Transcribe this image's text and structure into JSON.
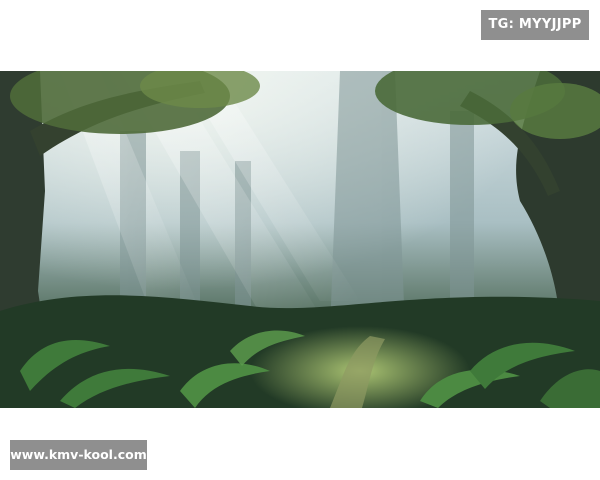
{
  "watermark_top": "TG: MYYJJPP",
  "watermark_bottom": "www.kmv-kool.com",
  "image": {
    "subject": "misty-forest-path",
    "colors": {
      "mist": "#c8d6dc",
      "shadow": "#1f3326",
      "fern": "#3f7a3a",
      "light_path": "#a9c46a",
      "trunk": "#3d4a3c"
    }
  }
}
